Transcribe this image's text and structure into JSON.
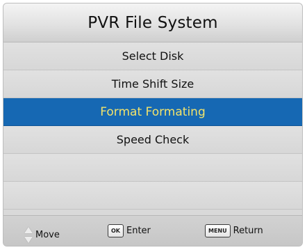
{
  "screen": {
    "title": "PVR File System"
  },
  "menu": {
    "items": [
      {
        "label": "Select Disk",
        "selected": false
      },
      {
        "label": "Time Shift Size",
        "selected": false
      },
      {
        "label": "Format Formating",
        "selected": true
      },
      {
        "label": "Speed Check",
        "selected": false
      },
      {
        "label": "",
        "selected": false
      },
      {
        "label": "",
        "selected": false
      }
    ]
  },
  "footer": {
    "move_label": "Move",
    "ok_key": "OK",
    "enter_label": "Enter",
    "menu_key": "MENU",
    "return_label": "Return"
  },
  "colors": {
    "selection_background": "#1668b3",
    "selection_text": "#f2e36b",
    "panel_background": "#d9d9d9"
  },
  "icons": {
    "move": "up-down-arrows-icon"
  }
}
